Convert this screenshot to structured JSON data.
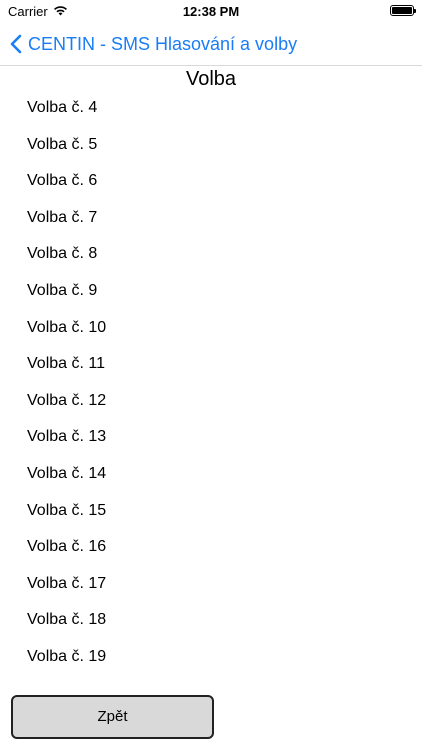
{
  "status_bar": {
    "carrier": "Carrier",
    "time": "12:38 PM"
  },
  "nav": {
    "back_label": "CENTIN - SMS Hlasování a volby"
  },
  "page": {
    "title": "Volba"
  },
  "list": {
    "items": [
      "Volba č. 4",
      "Volba č. 5",
      "Volba č. 6",
      "Volba č. 7",
      "Volba č. 8",
      "Volba č. 9",
      "Volba č. 10",
      "Volba č. 11",
      "Volba č. 12",
      "Volba č. 13",
      "Volba č. 14",
      "Volba č. 15",
      "Volba č. 16",
      "Volba č. 17",
      "Volba č. 18",
      "Volba č. 19"
    ]
  },
  "footer": {
    "back_button_label": "Zpět"
  },
  "colors": {
    "accent": "#1a7df5",
    "button_bg": "#d9d9d9"
  }
}
